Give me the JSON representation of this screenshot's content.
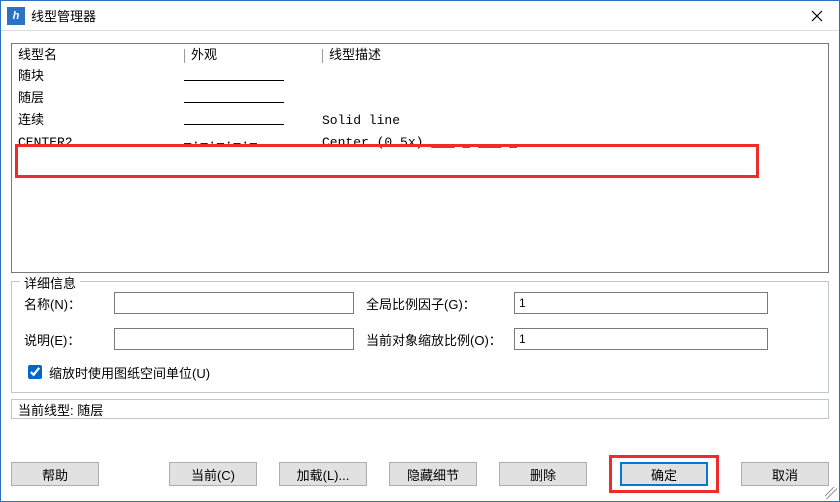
{
  "window": {
    "title": "线型管理器",
    "icon_letter": "h"
  },
  "columns": {
    "name": "线型名",
    "appearance": "外观",
    "description": "线型描述"
  },
  "rows": [
    {
      "name": "随块",
      "preview": "solid",
      "description": ""
    },
    {
      "name": "随层",
      "preview": "solid",
      "description": ""
    },
    {
      "name": "连续",
      "preview": "solid",
      "description": "Solid line"
    },
    {
      "name": "CENTER2",
      "preview": "dashdot",
      "description": "Center (0.5x) ___ _ ___ _ ..."
    }
  ],
  "details": {
    "group_title": "详细信息",
    "name_label": "名称(N)：",
    "name_value": "",
    "explain_label": "说明(E)：",
    "explain_value": "",
    "global_label": "全局比例因子(G)：",
    "global_value": "1",
    "current_scale_label": "当前对象缩放比例(O)：",
    "current_scale_value": "1",
    "checkbox_label": "缩放时使用图纸空间单位(U)",
    "checkbox_checked": true
  },
  "current_line": {
    "label": "当前线型:",
    "value": "随层"
  },
  "buttons": {
    "help": "帮助",
    "current": "当前(C)",
    "load": "加载(L)...",
    "hide_detail": "隐藏细节",
    "delete": "删除",
    "ok": "确定",
    "cancel": "取消"
  }
}
